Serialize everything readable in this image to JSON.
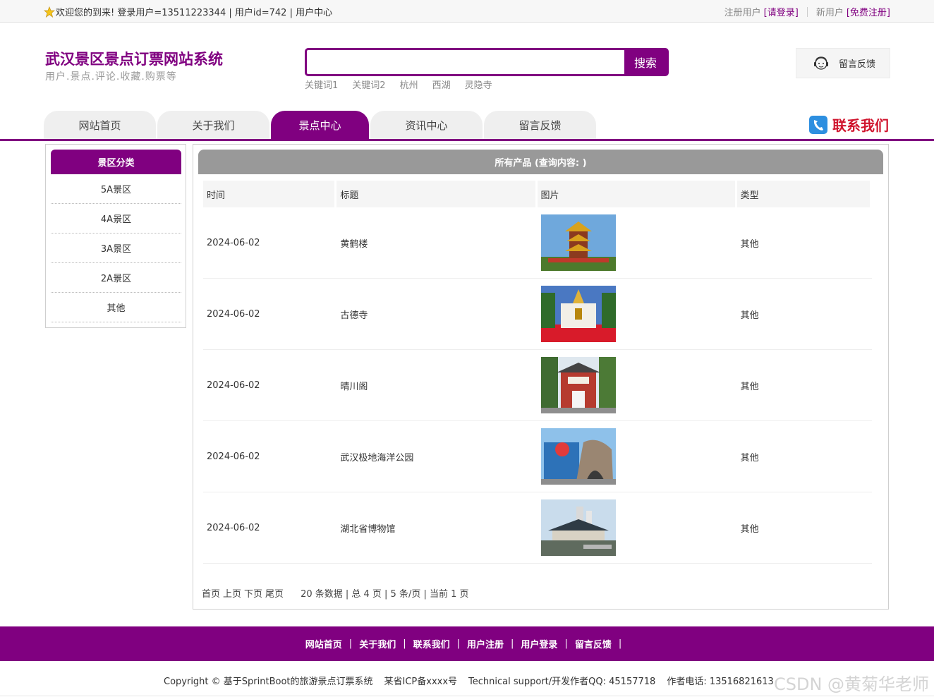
{
  "topbar": {
    "welcome": "欢迎您的到来!  登录用户=13511223344 | 用户id=742 | 用户中心",
    "register_prefix": "注册用户",
    "login_link": "[请登录]",
    "new_user_prefix": "新用户",
    "register_link": "[免费注册]"
  },
  "header": {
    "title": "武汉景区景点订票网站系统",
    "subtitle": "用户.景点.评论.收藏.购票等",
    "search_placeholder": "",
    "search_button": "搜索",
    "keywords": [
      "关键词1",
      "关键词2",
      "杭州",
      "西湖",
      "灵隐寺"
    ],
    "feedback": "留言反馈"
  },
  "nav": {
    "tabs": [
      "网站首页",
      "关于我们",
      "景点中心",
      "资讯中心",
      "留言反馈"
    ],
    "active_index": 2,
    "contact": "联系我们"
  },
  "sidebar": {
    "title": "景区分类",
    "items": [
      "5A景区",
      "4A景区",
      "3A景区",
      "2A景区",
      "其他"
    ]
  },
  "main": {
    "title": "所有产品 (查询内容: )",
    "columns": [
      "时间",
      "标题",
      "图片",
      "类型"
    ],
    "rows": [
      {
        "date": "2024-06-02",
        "title": "黄鹤楼",
        "type": "其他"
      },
      {
        "date": "2024-06-02",
        "title": "古德寺",
        "type": "其他"
      },
      {
        "date": "2024-06-02",
        "title": "晴川阁",
        "type": "其他"
      },
      {
        "date": "2024-06-02",
        "title": "武汉极地海洋公园",
        "type": "其他"
      },
      {
        "date": "2024-06-02",
        "title": "湖北省博物馆",
        "type": "其他"
      }
    ],
    "pager": {
      "first": "首页",
      "prev": "上页",
      "next": "下页",
      "last": "尾页",
      "info": "20 条数据 | 总 4 页 | 5 条/页 | 当前 1 页"
    }
  },
  "footer": {
    "links": [
      "网站首页",
      "关于我们",
      "联系我们",
      "用户注册",
      "用户登录",
      "留言反馈"
    ],
    "copyright": "Copyright © 基于SprintBoot的旅游景点订票系统",
    "icp": "某省ICP备xxxx号",
    "support": "Technical support/开发作者QQ:  45157718",
    "phone": "作者电话:  13516821613",
    "watermark": "CSDN @黄菊华老师"
  },
  "colors": {
    "brand": "#800080",
    "contact_red": "#d0152e",
    "panel_head": "#999999"
  }
}
